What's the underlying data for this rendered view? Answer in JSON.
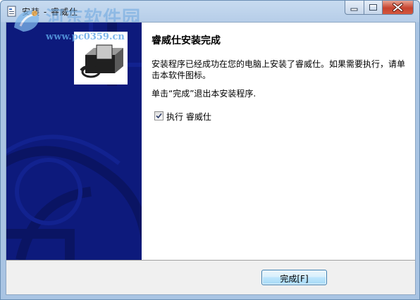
{
  "window": {
    "title": "安装 - 睿威仕",
    "watermark_text": "河东软件园",
    "watermark_url": "www.pc0359.cn"
  },
  "page": {
    "heading": "睿威仕安装完成",
    "message": "安装程序已经成功在您的电脑上安装了睿威仕。如果需要执行，请单击本软件图标。",
    "instruction": "单击“完成”退出本安装程序.",
    "run_checkbox": {
      "label": "执行 睿威仕",
      "checked": true
    }
  },
  "buttons": {
    "finish": "完成[F]"
  },
  "colors": {
    "sidebar": "#0d1a7c",
    "accent": "#3c7fb1"
  }
}
